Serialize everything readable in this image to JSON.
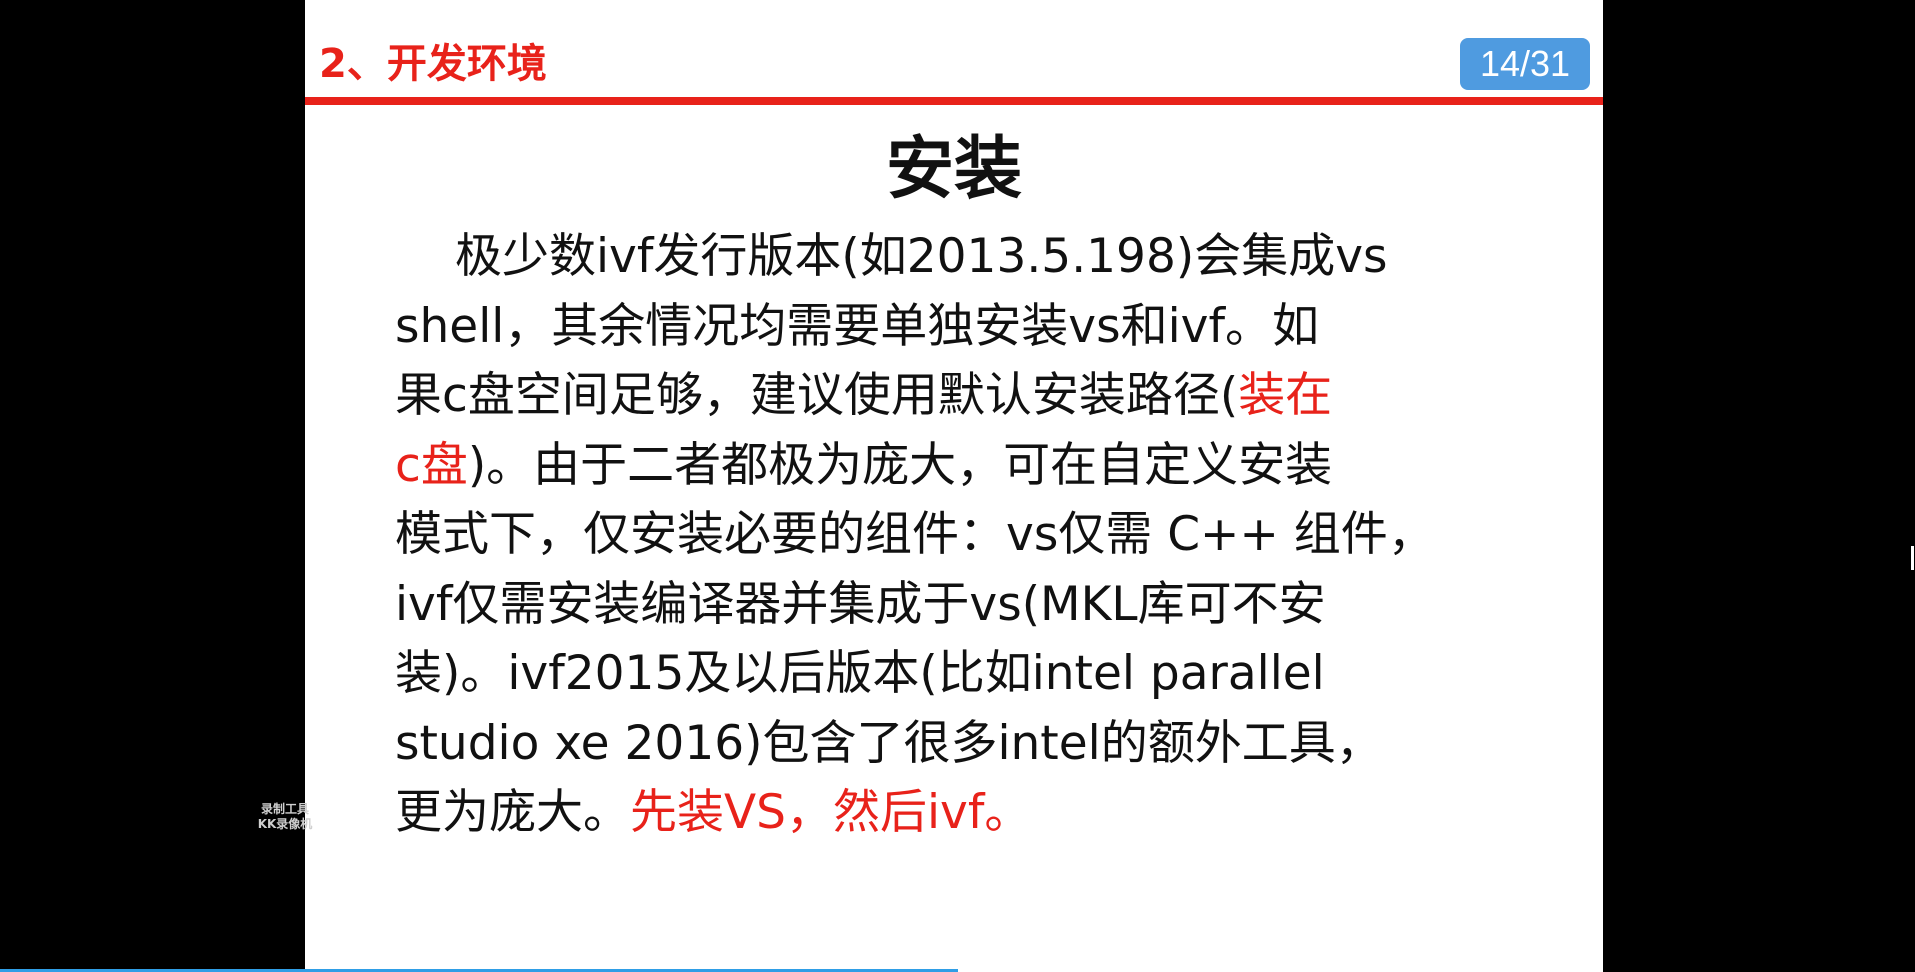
{
  "slide": {
    "section_title": "2、开发环境",
    "page_indicator": "14/31",
    "heading": "安装",
    "body": {
      "l1": "极少数ivf发行版本(如2013.5.198)会集成vs",
      "l2": "shell，其余情况均需要单独安装vs和ivf。如",
      "l3a": "果c盘空间足够，建议使用默认安装路径(",
      "l3b": "装在",
      "l4a": "c盘",
      "l4b": ")。由于二者都极为庞大，可在自定义安装",
      "l5": "模式下，仅安装必要的组件：vs仅需 C++ 组件，",
      "l6": "ivf仅需安装编译器并集成于vs(MKL库可不安",
      "l7": "装)。ivf2015及以后版本(比如intel parallel",
      "l8": "studio xe 2016)包含了很多intel的额外工具，",
      "l9a": "更为庞大。",
      "l9b": "先装VS，然后ivf。"
    }
  },
  "watermark": {
    "line1": "录制工具",
    "line2": "KK录像机"
  },
  "player": {
    "progress_fraction": 0.5
  },
  "colors": {
    "accent_red": "#e8221a",
    "badge_blue": "#4f9be0",
    "progress_blue": "#2f9ee6",
    "background": "#000000",
    "slide_bg": "#ffffff"
  }
}
